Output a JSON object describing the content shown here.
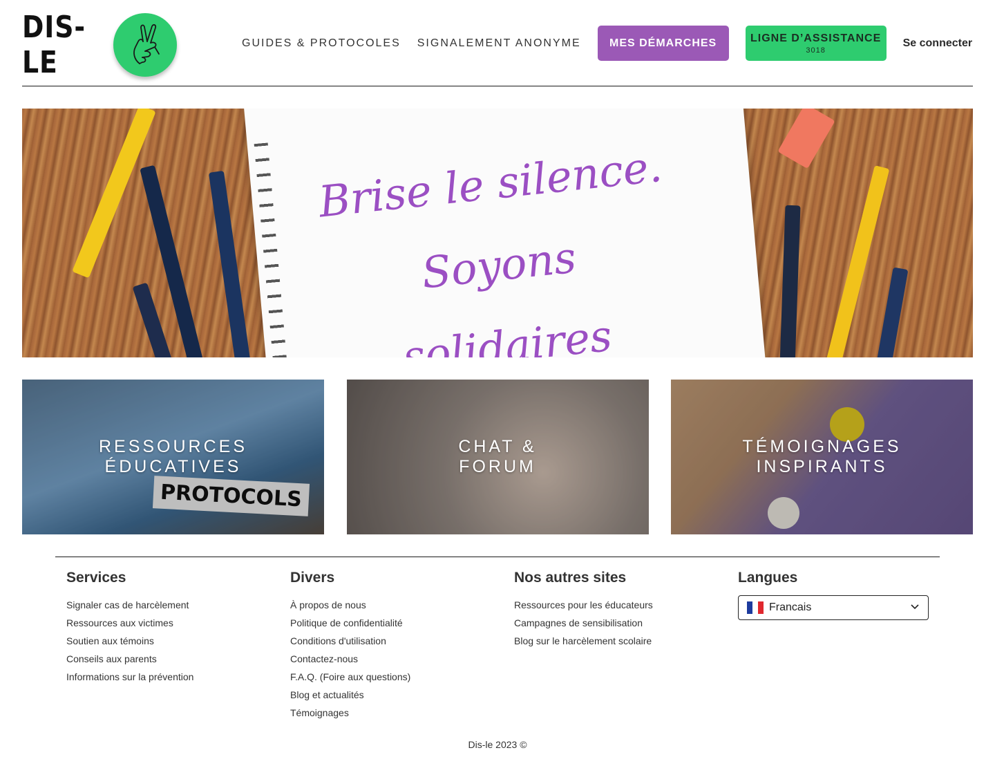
{
  "brand": {
    "name": "DIS-LE",
    "logo_icon": "crossed-fingers-icon",
    "green": "#2ecc6f",
    "purple": "#9b59b6"
  },
  "nav": {
    "guides": "GUIDES & PROTOCOLES",
    "signalement": "SIGNALEMENT ANONYME",
    "demarches": "MES DÉMARCHES",
    "assistance": "LIGNE D’ASSISTANCE",
    "assistance_number": "3018",
    "login": "Se connecter"
  },
  "hero": {
    "line1": "Brise le silence.",
    "line2": "Soyons",
    "line3": "solidaires"
  },
  "tiles": [
    {
      "line1": "RESSOURCES",
      "line2": "ÉDUCATIVES",
      "label": "PROTOCOLS"
    },
    {
      "line1": "CHAT &",
      "line2": "FORUM"
    },
    {
      "line1": "TÉMOIGNAGES",
      "line2": "INSPIRANTS"
    }
  ],
  "footer": {
    "services": {
      "title": "Services",
      "links": [
        "Signaler cas de harcèlement",
        "Ressources aux victimes",
        "Soutien aux témoins",
        "Conseils aux parents",
        "Informations sur la prévention"
      ]
    },
    "divers": {
      "title": "Divers",
      "links": [
        "À propos de nous",
        "Politique de confidentialité",
        "Conditions d'utilisation",
        "Contactez-nous",
        "F.A.Q. (Foire aux questions)",
        "Blog et actualités",
        "Témoignages"
      ]
    },
    "autres": {
      "title": "Nos autres sites",
      "links": [
        "Ressources pour les éducateurs",
        "Campagnes de sensibilisation",
        "Blog sur le harcèlement scolaire"
      ]
    },
    "langues": {
      "title": "Langues",
      "selected": "Francais",
      "flag_colors": [
        "#1d3b9e",
        "#ffffff",
        "#e0282e"
      ]
    },
    "copyright": "Dis-le 2023 ©"
  }
}
